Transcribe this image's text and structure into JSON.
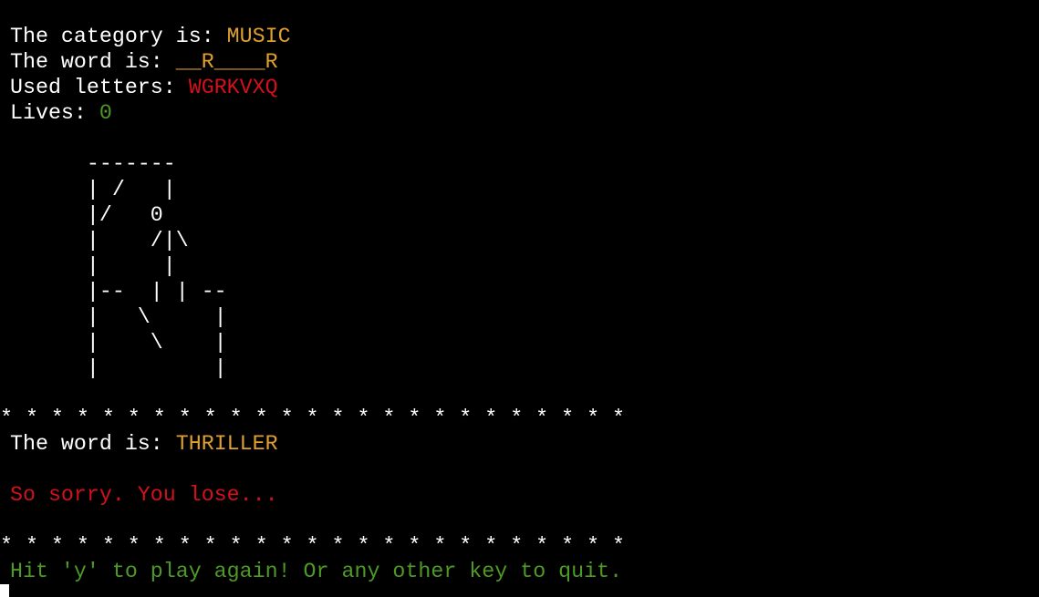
{
  "status": {
    "category_label": "The category is: ",
    "category_value": "MUSIC",
    "word_label": "The word is: ",
    "word_value": "__R____R",
    "used_label": "Used letters: ",
    "used_value": "WGRKVXQ",
    "lives_label": "Lives: ",
    "lives_value": "0"
  },
  "gallows": [
    "      -------",
    "      | /   |",
    "      |/   0",
    "      |    /|\\",
    "      |     |",
    "      |--  | | --",
    "      |   \\     |",
    "      |    \\    |",
    "      |         |"
  ],
  "separator": "* * * * * * * * * * * * * * * * * * * * * * * * *",
  "result": {
    "word_label": "The word is: ",
    "word_value": "THRILLER",
    "message": "So sorry. You lose..."
  },
  "prompt": "Hit 'y' to play again! Or any other key to quit.",
  "colors": {
    "background": "#000000",
    "text": "#ffffff",
    "highlight": "#e0a030",
    "error": "#d4101a",
    "success": "#4e9a26"
  }
}
